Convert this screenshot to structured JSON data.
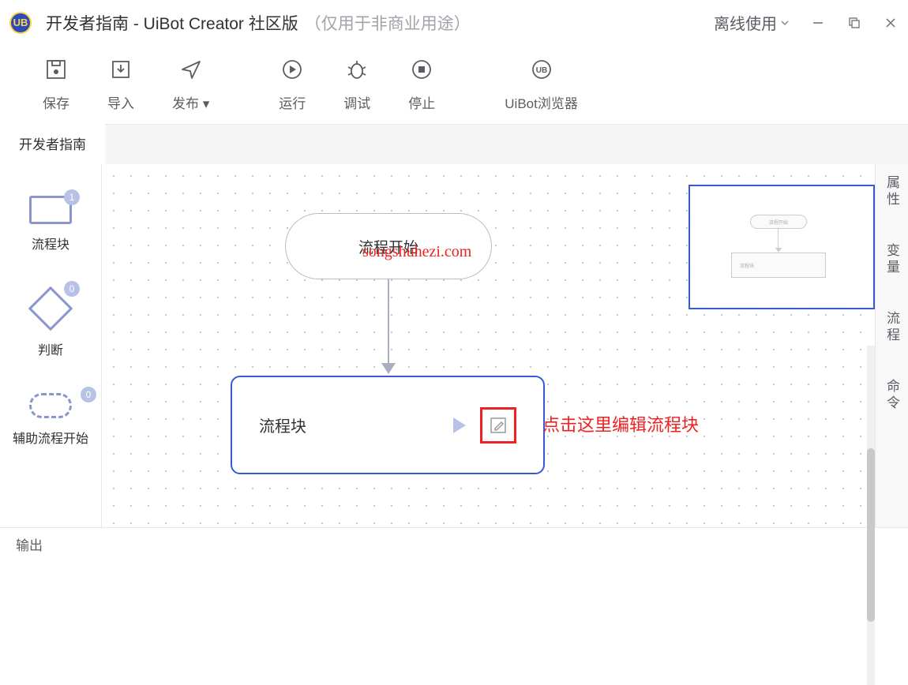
{
  "titlebar": {
    "doc_name": "开发者指南",
    "app_name": "UiBot Creator 社区版",
    "note": "（仅用于非商业用途）",
    "offline": "离线使用",
    "app_icon_text": "UB"
  },
  "toolbar": {
    "save": "保存",
    "import": "导入",
    "publish": "发布",
    "run": "运行",
    "debug": "调试",
    "stop": "停止",
    "browser": "UiBot浏览器"
  },
  "tab": {
    "active": "开发者指南"
  },
  "palette": {
    "block": {
      "label": "流程块",
      "badge": "1"
    },
    "decision": {
      "label": "判断",
      "badge": "0"
    },
    "aux": {
      "label": "辅助流程开始",
      "badge": "0"
    }
  },
  "canvas": {
    "start_label": "流程开始",
    "block_label": "流程块"
  },
  "annotation": {
    "callout": "点击这里编辑流程块",
    "watermark": "songshuhezi.com"
  },
  "right_tabs": {
    "properties": "属性",
    "variables": "变量",
    "flow": "流程",
    "commands": "命令"
  },
  "bottom": {
    "output": "输出"
  },
  "minimap": {
    "start": "流程开始",
    "block": "流程块"
  }
}
